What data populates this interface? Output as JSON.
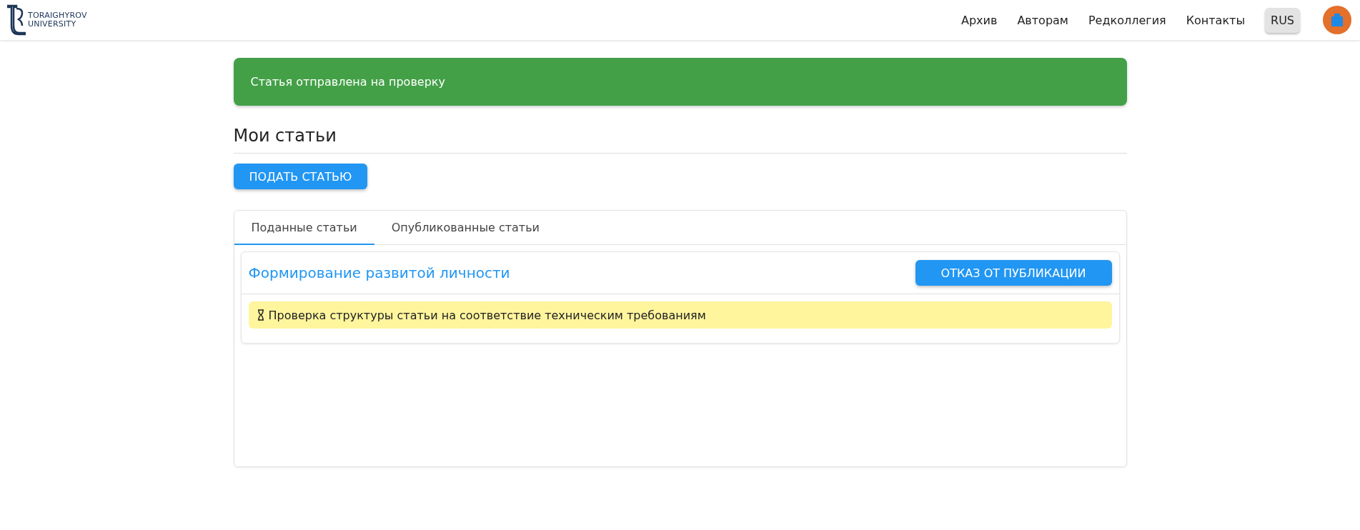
{
  "header": {
    "logo": {
      "line_1": "TORAIGHYROV",
      "line_2": "UNIVERSITY"
    },
    "nav": [
      "Архив",
      "Авторам",
      "Редколлегия",
      "Контакты"
    ],
    "language": "RUS"
  },
  "alert": {
    "text": "Статья отправлена на проверку"
  },
  "page_title": "Мои статьи",
  "submit_button": "ПОДАТЬ СТАТЬЮ",
  "tabs": [
    {
      "label": "Поданные статьи",
      "selected": true
    },
    {
      "label": "Опубликованные статьи",
      "selected": false
    }
  ],
  "articles": [
    {
      "title": "Формирование развитой личности",
      "action": "ОТКАЗ ОТ ПУБЛИКАЦИИ",
      "status": "Проверка структуры статьи на соответствие техническим требованиям"
    }
  ]
}
